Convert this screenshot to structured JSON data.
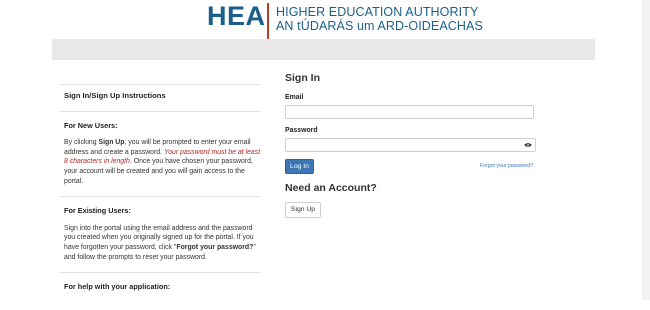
{
  "header": {
    "logo_abbr": "HEA",
    "logo_name": "HIGHER EDUCATION AUTHORITY",
    "logo_irish": "AN tÚDARÁS um ARD-OIDEACHAS"
  },
  "instructions": {
    "title": "Sign In/Sign Up Instructions",
    "new_users": {
      "title": "For New Users:",
      "t1": "By clicking ",
      "t2": "Sign Up",
      "t3": ", you will be prompted to enter your email address and create a password. ",
      "t4": "Your password must be at least 8 characters in length",
      "t5": ". Once you have chosen your password, your account will be created and you will gain access to the portal."
    },
    "existing_users": {
      "title": "For Existing Users:",
      "t1": "Sign into the portal using the email address and the password you created when you originally signed up for the portal. If you have forgotten your password, click \"",
      "t2": "Forgot your password?",
      "t3": "\" and follow the prompts to reset your password."
    },
    "help": {
      "title": "For help with your application:"
    }
  },
  "signin": {
    "heading": "Sign In",
    "email_label": "Email",
    "password_label": "Password",
    "login_button": "Log In",
    "forgot_link": "Forgot your password?",
    "need_account": "Need an Account?",
    "signup_button": "Sign Up"
  },
  "colors": {
    "brand_blue": "#1b5f8a",
    "accent_red": "#c0392b",
    "button_blue": "#3c77b3"
  }
}
